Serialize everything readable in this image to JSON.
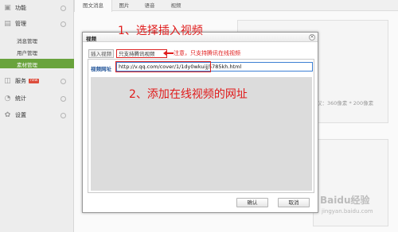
{
  "sidebar": {
    "items": [
      {
        "label": "功能",
        "icon": "function-icon"
      },
      {
        "label": "管理",
        "icon": "manage-icon"
      },
      {
        "label": "服务",
        "icon": "service-icon",
        "badge": "new"
      },
      {
        "label": "统计",
        "icon": "stats-icon"
      },
      {
        "label": "设置",
        "icon": "settings-icon"
      }
    ],
    "sub_items": [
      {
        "label": "消息管理"
      },
      {
        "label": "用户管理"
      },
      {
        "label": "素材管理",
        "active": true
      }
    ]
  },
  "tabs": [
    {
      "label": "图文消息",
      "active": true
    },
    {
      "label": "图片"
    },
    {
      "label": "语音"
    },
    {
      "label": "视频"
    }
  ],
  "background": {
    "hint": "议：360像素 * 200像素"
  },
  "dialog": {
    "title": "视频",
    "close_symbol": "×",
    "tabs": [
      {
        "label": "插入视频"
      },
      {
        "label": "只支持腾讯视频"
      }
    ],
    "url_label": "视频网址",
    "url_value": "http://v.qq.com/cover/1/1dy0wkuijj5785kh.html",
    "ok_label": "确认",
    "cancel_label": "取消"
  },
  "annotations": {
    "step1": "1、选择插入视频",
    "note": "注意，只支持腾讯在线视频",
    "step2": "2、添加在线视频的网址"
  },
  "watermark": {
    "text": "Baidu经验",
    "sub": "jingyan.baidu.com"
  },
  "colors": {
    "accent_green": "#6ca73e",
    "annotation_red": "#e01b1b",
    "input_border": "#3c7fd3"
  }
}
